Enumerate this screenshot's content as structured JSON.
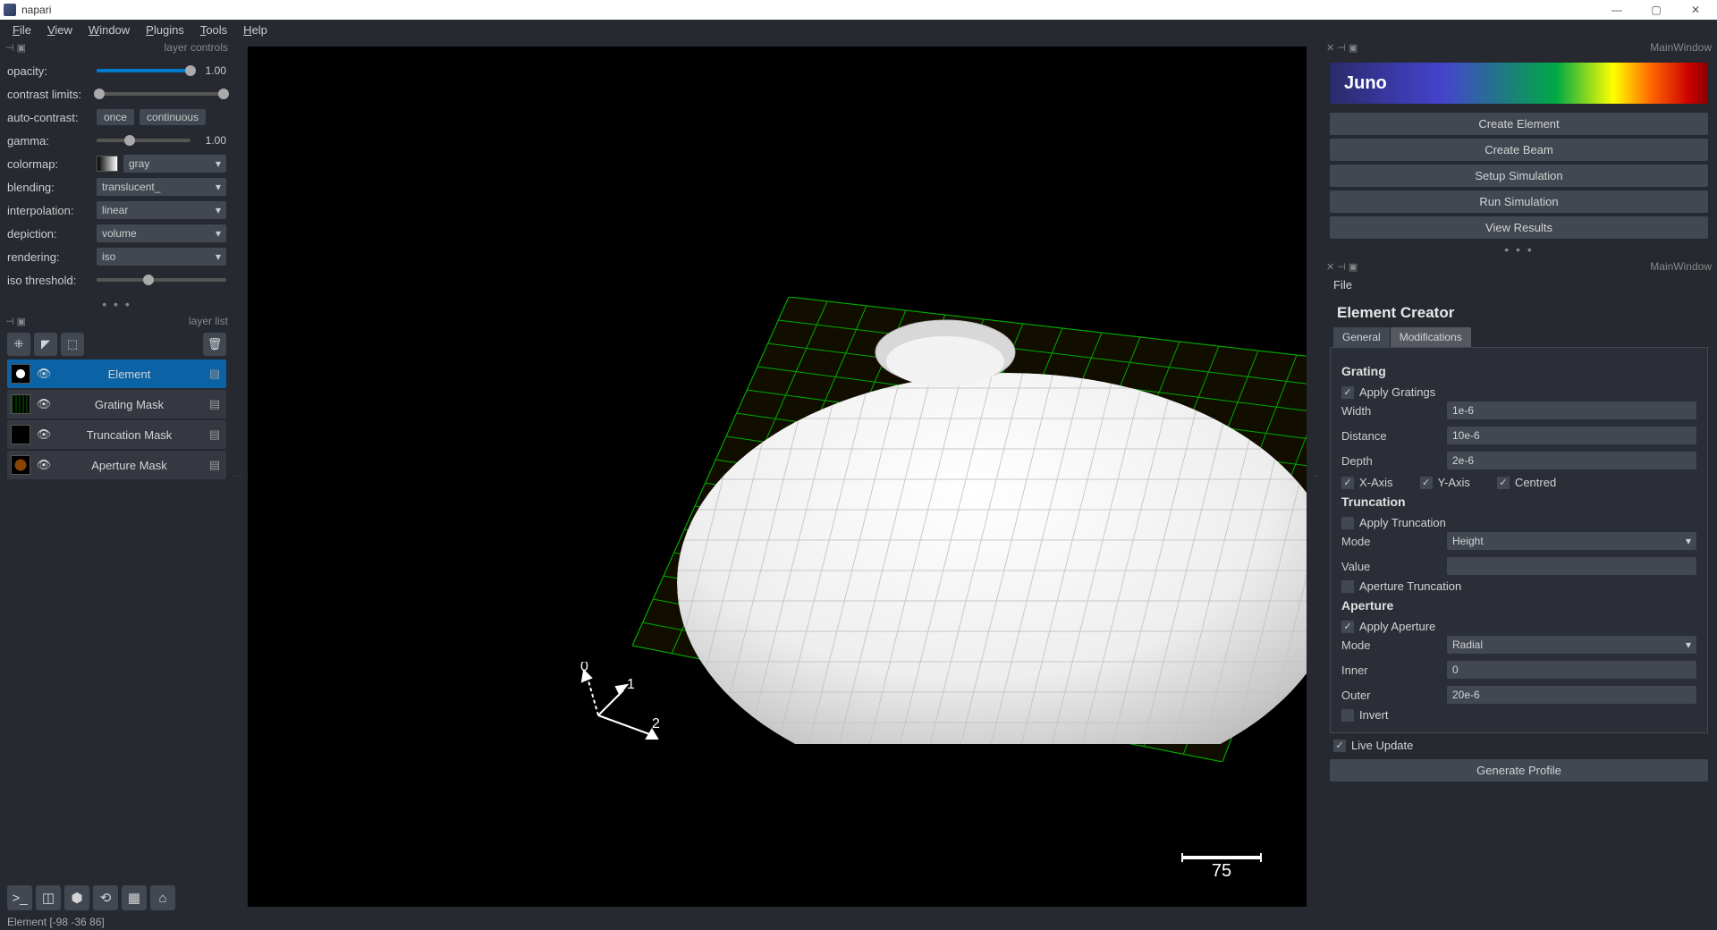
{
  "app": {
    "title": "napari"
  },
  "menubar": [
    {
      "l": "F",
      "rest": "ile"
    },
    {
      "l": "V",
      "rest": "iew"
    },
    {
      "l": "W",
      "rest": "indow"
    },
    {
      "l": "P",
      "rest": "lugins"
    },
    {
      "l": "T",
      "rest": "ools"
    },
    {
      "l": "H",
      "rest": "elp"
    }
  ],
  "dock_headers": {
    "layer_controls": "layer controls",
    "layer_list": "layer list",
    "main1": "MainWindow",
    "main2": "MainWindow"
  },
  "layer_controls": {
    "opacity_label": "opacity:",
    "opacity_val": "1.00",
    "contrast_label": "contrast limits:",
    "autocontrast_label": "auto-contrast:",
    "once": "once",
    "continuous": "continuous",
    "gamma_label": "gamma:",
    "gamma_val": "1.00",
    "colormap_label": "colormap:",
    "colormap_val": "gray",
    "blending_label": "blending:",
    "blending_val": "translucent_",
    "interpolation_label": "interpolation:",
    "interpolation_val": "linear",
    "depiction_label": "depiction:",
    "depiction_val": "volume",
    "rendering_label": "rendering:",
    "rendering_val": "iso",
    "iso_label": "iso threshold:"
  },
  "layers": [
    {
      "name": "Element",
      "selected": true
    },
    {
      "name": "Grating Mask",
      "selected": false
    },
    {
      "name": "Truncation Mask",
      "selected": false
    },
    {
      "name": "Aperture Mask",
      "selected": false
    }
  ],
  "viewport": {
    "axis0": "0",
    "axis1": "1",
    "axis2": "2",
    "scale_value": "75"
  },
  "statusbar": "Element [-98 -36  86]",
  "juno": {
    "logo": "Juno",
    "buttons": [
      "Create Element",
      "Create Beam",
      "Setup Simulation",
      "Run Simulation",
      "View Results"
    ]
  },
  "file_menu": "File",
  "element_creator": {
    "title": "Element Creator",
    "tabs": {
      "general": "General",
      "modifications": "Modifications"
    },
    "grating": {
      "heading": "Grating",
      "apply": "Apply Gratings",
      "width_label": "Width",
      "width_val": "1e-6",
      "distance_label": "Distance",
      "distance_val": "10e-6",
      "depth_label": "Depth",
      "depth_val": "2e-6",
      "xaxis": "X-Axis",
      "yaxis": "Y-Axis",
      "centred": "Centred"
    },
    "truncation": {
      "heading": "Truncation",
      "apply": "Apply Truncation",
      "mode_label": "Mode",
      "mode_val": "Height",
      "value_label": "Value",
      "value_val": "",
      "aperture_trunc": "Aperture Truncation"
    },
    "aperture": {
      "heading": "Aperture",
      "apply": "Apply Aperture",
      "mode_label": "Mode",
      "mode_val": "Radial",
      "inner_label": "Inner",
      "inner_val": "0",
      "outer_label": "Outer",
      "outer_val": "20e-6",
      "invert": "Invert"
    },
    "live_update": "Live Update",
    "generate": "Generate Profile"
  }
}
